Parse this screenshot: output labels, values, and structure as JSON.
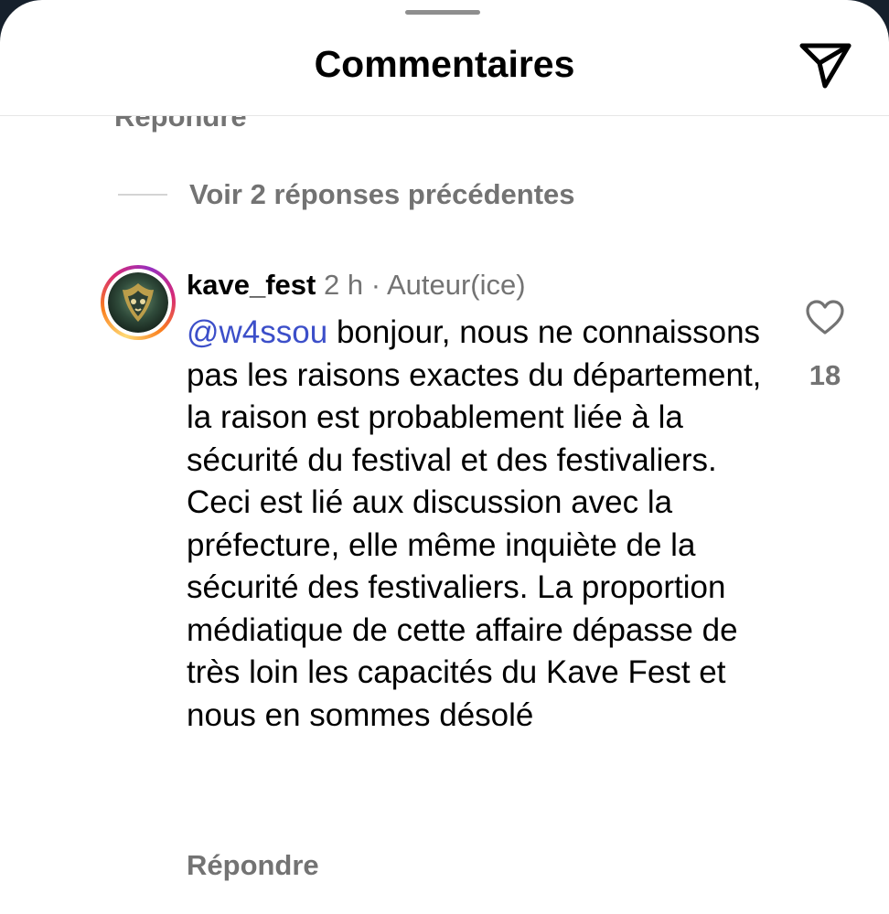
{
  "header": {
    "title": "Commentaires",
    "share_icon": "paper-plane-icon"
  },
  "thread": {
    "cut_reply_label": "Répondre",
    "view_previous_replies": "Voir 2 réponses précédentes"
  },
  "comment": {
    "username": "kave_fest",
    "time": "2 h",
    "separator": "·",
    "author_tag": "Auteur(ice)",
    "mention": "@w4ssou",
    "text": "bonjour, nous ne connaissons pas les raisons exactes du département, la raison est probablement liée à la sécurité du festival et des festivaliers. Ceci est lié aux discussion avec la préfecture, elle même inquiète de la sécurité des festivaliers. La proportion médiatique de cette affaire dépasse de très loin les capacités du Kave Fest et nous en sommes désolé",
    "reply_label": "Répondre",
    "like_count": "18",
    "like_icon": "heart-outline-icon"
  },
  "colors": {
    "mention": "#3c4fc9",
    "secondary_text": "#737373",
    "story_ring": [
      "#feda75",
      "#fa7e1e",
      "#d62976",
      "#962fbf"
    ]
  }
}
